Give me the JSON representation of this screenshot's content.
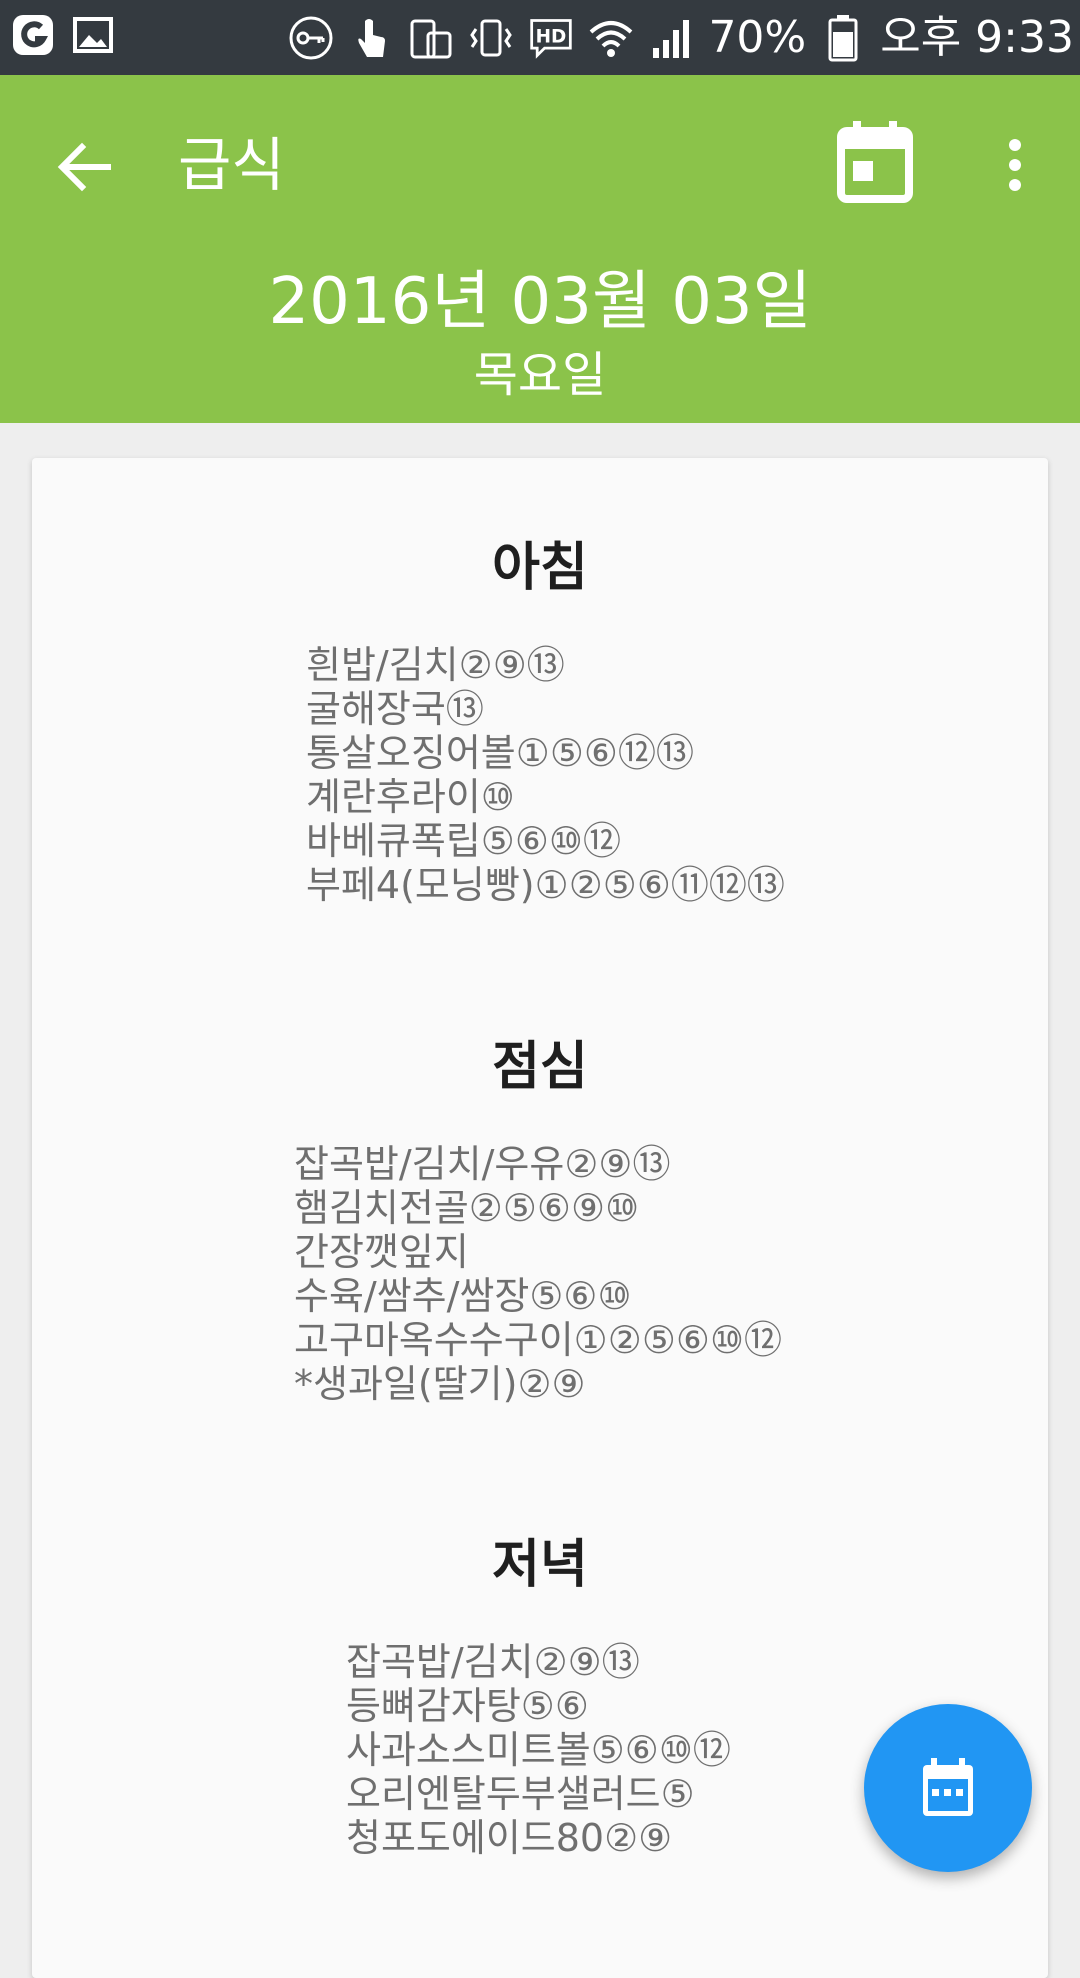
{
  "status_bar": {
    "battery_percent": "70%",
    "time": "오후 9:33"
  },
  "app_bar": {
    "title": "급식",
    "date": "2016년 03월 03일",
    "weekday": "목요일"
  },
  "meals": [
    {
      "title": "아침",
      "items": [
        "흰밥/김치②⑨⑬",
        "굴해장국⑬",
        "통살오징어볼①⑤⑥⑫⑬",
        "계란후라이⑩",
        "바베큐폭립⑤⑥⑩⑫",
        "부페4(모닝빵)①②⑤⑥⑪⑫⑬"
      ]
    },
    {
      "title": "점심",
      "items": [
        "잡곡밥/김치/우유②⑨⑬",
        "햄김치전골②⑤⑥⑨⑩",
        "간장깻잎지",
        "수육/쌈추/쌈장⑤⑥⑩",
        "고구마옥수수구이①②⑤⑥⑩⑫",
        "*생과일(딸기)②⑨"
      ]
    },
    {
      "title": "저녁",
      "items": [
        "잡곡밥/김치②⑨⑬",
        "등뼈감자탕⑤⑥",
        "사과소스미트볼⑤⑥⑩⑫",
        "오리엔탈두부샐러드⑤",
        "청포도에이드80②⑨"
      ]
    }
  ],
  "colors": {
    "app_bar": "#8bc34a",
    "status_bar": "#343a40",
    "fab": "#2196f3"
  }
}
